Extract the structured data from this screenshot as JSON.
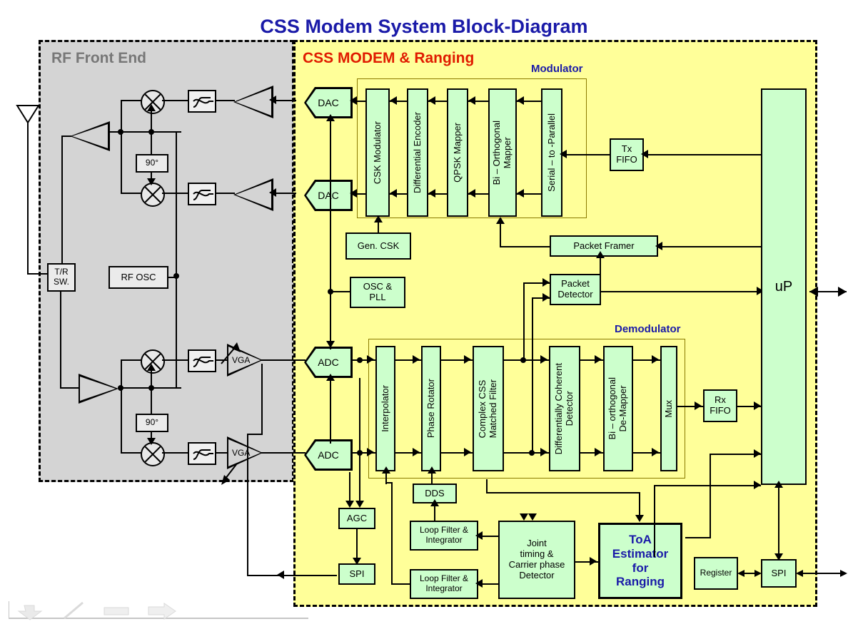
{
  "title": "CSS Modem System Block-Diagram",
  "colors": {
    "title_blue": "#1a1aa8",
    "accent_red": "#e01b00",
    "rf_panel": "#d4d4d4",
    "css_panel": "#ffff99",
    "block_green": "#ccffcc",
    "rf_label_gray": "#777777"
  },
  "regions": {
    "rf_front_end": {
      "label": "RF Front End"
    },
    "css_modem": {
      "label": "CSS MODEM & Ranging"
    },
    "modulator": {
      "label": "Modulator"
    },
    "demodulator": {
      "label": "Demodulator"
    }
  },
  "rf": {
    "antenna": "antenna",
    "tr_switch": "T/R\nSW.",
    "tr_switch_l1": "T/R",
    "tr_switch_l2": "SW.",
    "rf_osc": "RF  OSC",
    "phase_shift_tx": "90°",
    "phase_shift_rx": "90°",
    "vga_i": "VGA",
    "vga_q": "VGA"
  },
  "converters": {
    "dac_i": "DAC",
    "dac_q": "DAC",
    "adc_i": "ADC",
    "adc_q": "ADC"
  },
  "modulator_chain": [
    {
      "label": "CSK Modulator"
    },
    {
      "label": "Differential Encoder"
    },
    {
      "label": "QPSK Mapper"
    },
    {
      "label": "Bi – Orthogonal\nMapper"
    },
    {
      "label": "Serial – to -Parallel"
    }
  ],
  "modulator_chain_lines": {
    "bi_orth_l1": "Bi – Orthogonal",
    "bi_orth_l2": "Mapper"
  },
  "demodulator_chain": [
    {
      "label": "Interpolator"
    },
    {
      "label": "Phase Rotator"
    },
    {
      "label": "Complex CSS\nMatched Filter"
    },
    {
      "label": "Differentially Coherent\nDetector"
    },
    {
      "label": "Bi – orthogonal\nDe-Mapper"
    },
    {
      "label": "Mux"
    }
  ],
  "demodulator_chain_lines": {
    "cssmf_l1": "Complex CSS",
    "cssmf_l2": "Matched Filter",
    "dcd_l1": "Differentially Coherent",
    "dcd_l2": "Detector",
    "biodm_l1": "Bi – orthogonal",
    "biodm_l2": "De-Mapper"
  },
  "blocks": {
    "gen_csk": "Gen. CSK",
    "osc_pll_l1": "OSC &",
    "osc_pll_l2": "PLL",
    "tx_fifo_l1": "Tx",
    "tx_fifo_l2": "FIFO",
    "rx_fifo_l1": "Rx",
    "rx_fifo_l2": "FIFO",
    "packet_framer": "Packet Framer",
    "packet_detector_l1": "Packet",
    "packet_detector_l2": "Detector",
    "up": "uP",
    "dds": "DDS",
    "agc": "AGC",
    "spi_left": "SPI",
    "spi_right": "SPI",
    "register": "Register",
    "loop_filter_1_l1": "Loop Filter &",
    "loop_filter_1_l2": "Integrator",
    "loop_filter_2_l1": "Loop Filter &",
    "loop_filter_2_l2": "Integrator",
    "joint_l1": "Joint",
    "joint_l2": "timing &",
    "joint_l3": "Carrier phase",
    "joint_l4": "Detector",
    "toa_l1": "ToA",
    "toa_l2": "Estimator",
    "toa_l3": "for",
    "toa_l4": "Ranging"
  }
}
